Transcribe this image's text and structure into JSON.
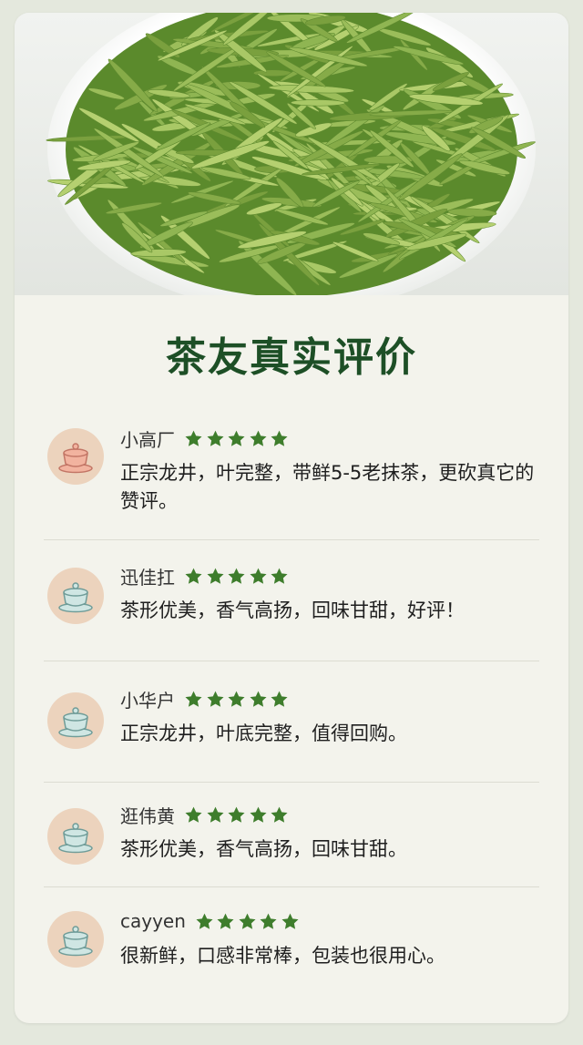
{
  "page": {
    "title": "茶友真实评价"
  },
  "colors": {
    "accent": "#1d4f26",
    "star": "#3e7d2c",
    "avatar_bg": "#ecd3bd"
  },
  "reviews": [
    {
      "name": "小高厂",
      "rating": 5,
      "text": "正宗龙井，叶完整，带鲜5-5老抹茶，更砍真它的赞评。",
      "avatar": "teacup-pink-icon"
    },
    {
      "name": "迅佳扛",
      "rating": 5,
      "text": "茶形优美，香气高扬，回味甘甜，好评！",
      "avatar": "teacup-blue-icon"
    },
    {
      "name": "小华户",
      "rating": 5,
      "text": "正宗龙井，叶底完整，值得回购。",
      "avatar": "teacup-blue-icon"
    },
    {
      "name": "逛伟黄",
      "rating": 5,
      "text": "茶形优美，香气高扬，回味甘甜。",
      "avatar": "teacup-blue-icon"
    },
    {
      "name": "cayyen",
      "rating": 5,
      "text": "很新鲜，口感非常棒，包装也很用心。",
      "avatar": "teacup-blue-icon"
    }
  ]
}
